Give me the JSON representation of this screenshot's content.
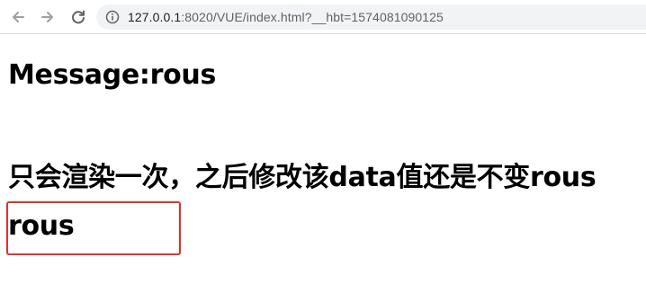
{
  "browser": {
    "url_host": "127.0.0.1",
    "url_rest": ":8020/VUE/index.html?__hbt=1574081090125"
  },
  "page": {
    "message_prefix": "Message:",
    "message_value": "rous",
    "once_text": "只会渲染一次，之后修改该data值还是不变rous",
    "plain_text": "rous"
  },
  "colors": {
    "highlight_border": "#d9342a"
  }
}
